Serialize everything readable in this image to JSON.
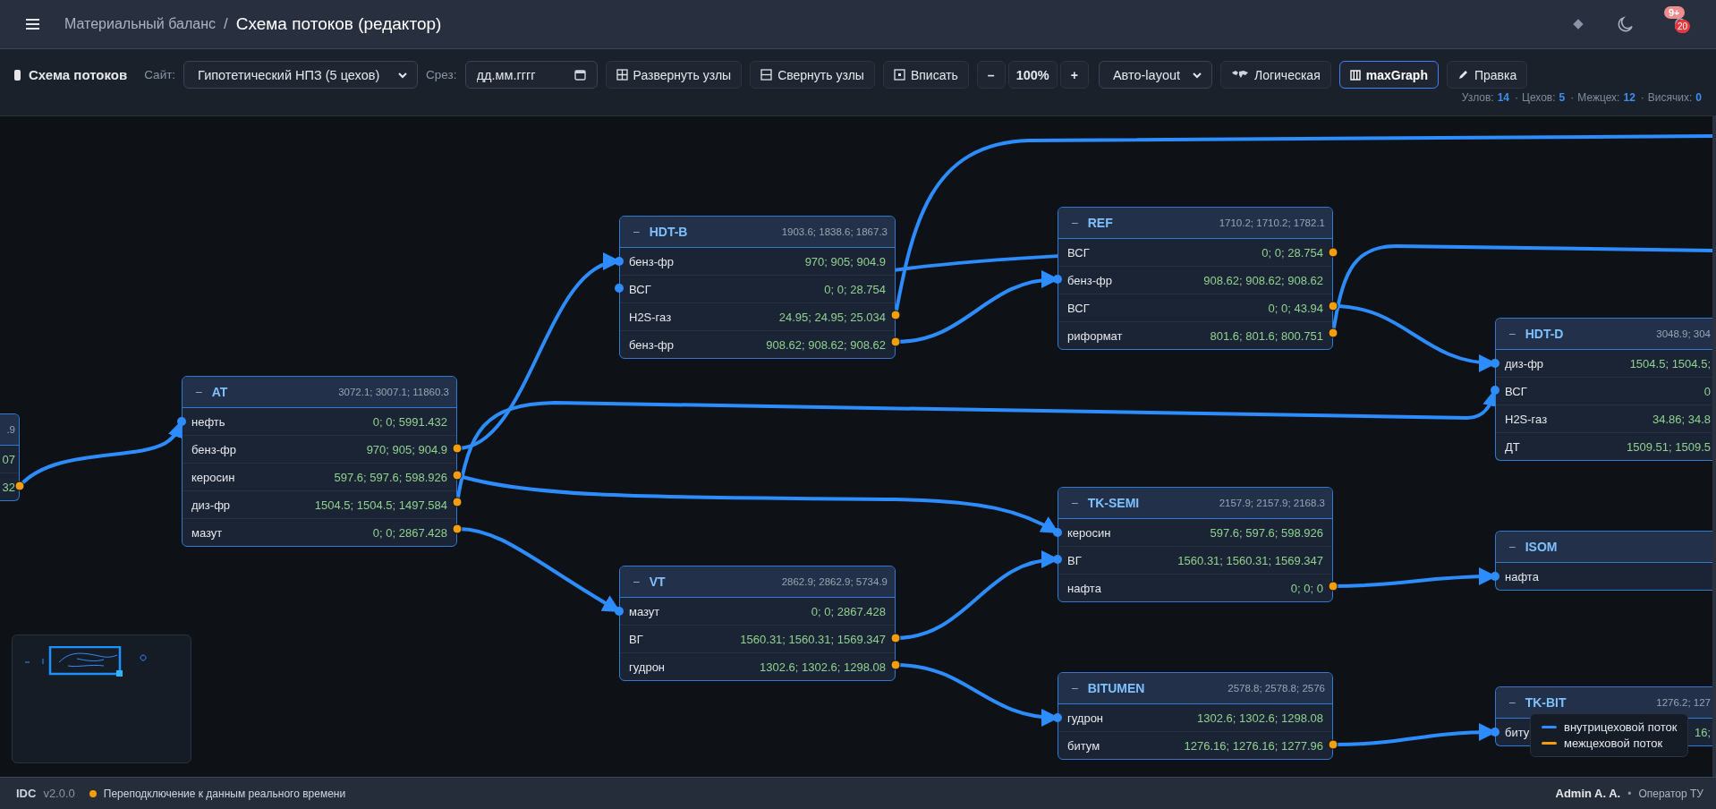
{
  "header": {
    "breadcrumb_parent": "Материальный баланс",
    "separator": "/",
    "title": "Схема потоков (редактор)",
    "notifications": {
      "badge": "9+",
      "count": "20"
    }
  },
  "toolbar": {
    "title": "Схема потоков",
    "site_label": "Сайт:",
    "site_value": "Гипотетический НПЗ (5 цехов)",
    "slice_label": "Срез:",
    "date": {
      "placeholder": "дд.мм.гггг"
    },
    "buttons": [
      {
        "label": "Развернуть узлы",
        "kind": "expand"
      },
      {
        "label": "Свернуть узлы",
        "kind": "collapse"
      },
      {
        "label": "Вписать",
        "kind": "fit"
      }
    ],
    "zoom": {
      "minus": "–",
      "value": "100%",
      "plus": "+"
    },
    "layout_value": "Авто-layout",
    "views": [
      {
        "label": "Логическая",
        "kind": "map",
        "selected": false
      },
      {
        "label": "maxGraph",
        "kind": "graph",
        "selected": true
      },
      {
        "label": "Правка",
        "kind": "edit",
        "selected": false
      }
    ],
    "stats": {
      "separator": "·",
      "items": [
        {
          "label": "Узлов:",
          "value": "14"
        },
        {
          "label": "Цехов:",
          "value": "5"
        },
        {
          "label": "Межцех:",
          "value": "12"
        },
        {
          "label": "Висячих:",
          "value": "0"
        }
      ]
    }
  },
  "nodes": [
    {
      "totals": ".9",
      "rows": [
        {
          "values": "07"
        },
        {
          "values": "32"
        }
      ]
    },
    {
      "toggle": "–",
      "name": "AT",
      "totals": "3072.1; 3007.1; 11860.3",
      "rows": [
        {
          "label": "нефть",
          "values": "0; 0; 5991.432"
        },
        {
          "label": "бенз-фр",
          "values": "970; 905; 904.9"
        },
        {
          "label": "керосин",
          "values": "597.6; 597.6; 598.926"
        },
        {
          "label": "диз-фр",
          "values": "1504.5; 1504.5; 1497.584"
        },
        {
          "label": "мазут",
          "values": "0; 0; 2867.428"
        }
      ]
    },
    {
      "toggle": "–",
      "name": "HDT-B",
      "totals": "1903.6; 1838.6; 1867.3",
      "rows": [
        {
          "label": "бенз-фр",
          "values": "970; 905; 904.9"
        },
        {
          "label": "ВСГ",
          "values": "0; 0; 28.754"
        },
        {
          "label": "H2S-газ",
          "values": "24.95; 24.95; 25.034"
        },
        {
          "label": "бенз-фр",
          "values": "908.62; 908.62; 908.62"
        }
      ]
    },
    {
      "toggle": "–",
      "name": "REF",
      "totals": "1710.2; 1710.2; 1782.1",
      "rows": [
        {
          "label": "ВСГ",
          "values": "0; 0; 28.754"
        },
        {
          "label": "бенз-фр",
          "values": "908.62; 908.62; 908.62"
        },
        {
          "label": "ВСГ",
          "values": "0; 0; 43.94"
        },
        {
          "label": "риформат",
          "values": "801.6; 801.6; 800.751"
        }
      ]
    },
    {
      "toggle": "–",
      "name": "HDT-D",
      "totals": "3048.9; 304",
      "rows": [
        {
          "label": "диз-фр",
          "values": "1504.5; 1504.5;"
        },
        {
          "label": "ВСГ",
          "values": "0"
        },
        {
          "label": "H2S-газ",
          "values": "34.86; 34.8"
        },
        {
          "label": "ДТ",
          "values": "1509.51; 1509.5"
        }
      ]
    },
    {
      "toggle": "–",
      "name": "TK-SEMI",
      "totals": "2157.9; 2157.9; 2168.3",
      "rows": [
        {
          "label": "керосин",
          "values": "597.6; 597.6; 598.926"
        },
        {
          "label": "ВГ",
          "values": "1560.31; 1560.31; 1569.347"
        },
        {
          "label": "нафта",
          "values": "0; 0; 0"
        }
      ]
    },
    {
      "toggle": "–",
      "name": "ISOM",
      "rows": [
        {
          "label": "нафта"
        }
      ]
    },
    {
      "toggle": "–",
      "name": "VT",
      "totals": "2862.9; 2862.9; 5734.9",
      "rows": [
        {
          "label": "мазут",
          "values": "0; 0; 2867.428"
        },
        {
          "label": "ВГ",
          "values": "1560.31; 1560.31; 1569.347"
        },
        {
          "label": "гудрон",
          "values": "1302.6; 1302.6; 1298.08"
        }
      ]
    },
    {
      "toggle": "–",
      "name": "BITUMEN",
      "totals": "2578.8; 2578.8; 2576",
      "rows": [
        {
          "label": "гудрон",
          "values": "1302.6; 1302.6; 1298.08"
        },
        {
          "label": "битум",
          "values": "1276.16; 1276.16; 1277.96"
        }
      ]
    },
    {
      "toggle": "–",
      "name": "TK-BIT",
      "totals": "1276.2; 127",
      "rows": [
        {
          "label": "биту",
          "values": "16;"
        }
      ]
    }
  ],
  "legend": [
    {
      "label": "внутрицеховой поток",
      "color": "#2d8cff"
    },
    {
      "label": "межцеховой поток",
      "color": "#f59e0b"
    }
  ],
  "status_bar": {
    "app": "IDC",
    "version": "v2.0.0",
    "connection": {
      "text": "Переподключение к данным реального времени",
      "color": "#f59e0b"
    },
    "user": "Admin A. A.",
    "separator": "•",
    "role": "Оператор ТУ"
  }
}
